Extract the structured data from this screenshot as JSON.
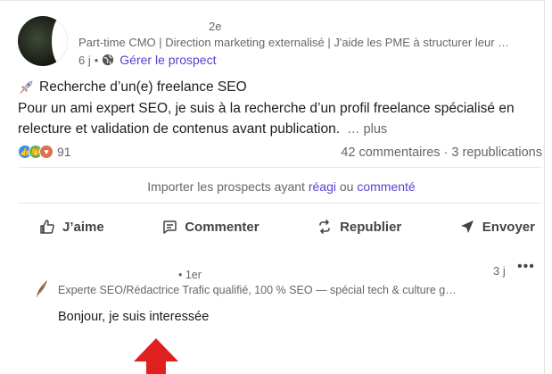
{
  "post": {
    "author_degree": "2e",
    "headline": "Part-time CMO | Direction marketing externalisé | J'aide les PME à structurer leur …",
    "time": "6 j",
    "time_sep": "•",
    "manage_label": "Gérer le prospect",
    "title": "Recherche d’un(e) freelance SEO",
    "body": "Pour un ami expert SEO, je suis à la recherche d’un profil freelance spécialisé en relecture et validation de contenus avant publication.",
    "more_label": "… plus"
  },
  "social": {
    "reaction_count": "91",
    "comments_reposts": "42 commentaires · 3 republications"
  },
  "import": {
    "prefix": "Importer les prospects ayant",
    "reacted": "réagi",
    "or": "ou",
    "commented": "commenté"
  },
  "actions": {
    "like": "J’aime",
    "comment": "Commenter",
    "repost": "Republier",
    "send": "Envoyer"
  },
  "comment": {
    "degree": "• 1er",
    "time": "3 j",
    "more": "•••",
    "headline": "Experte SEO/Rédactrice Trafic qualifié, 100 % SEO — spécial tech & culture g…",
    "text": "Bonjour, je suis interessée"
  },
  "colors": {
    "accent": "#5a3fd1",
    "arrow": "#e01f1f",
    "like": "#378fe9",
    "celebrate": "#6dae4f",
    "love": "#df704d"
  },
  "icons": [
    "globe-icon",
    "rocket-icon",
    "like-icon",
    "comment-icon",
    "repost-icon",
    "send-icon",
    "more-icon",
    "arrow-up-icon"
  ]
}
